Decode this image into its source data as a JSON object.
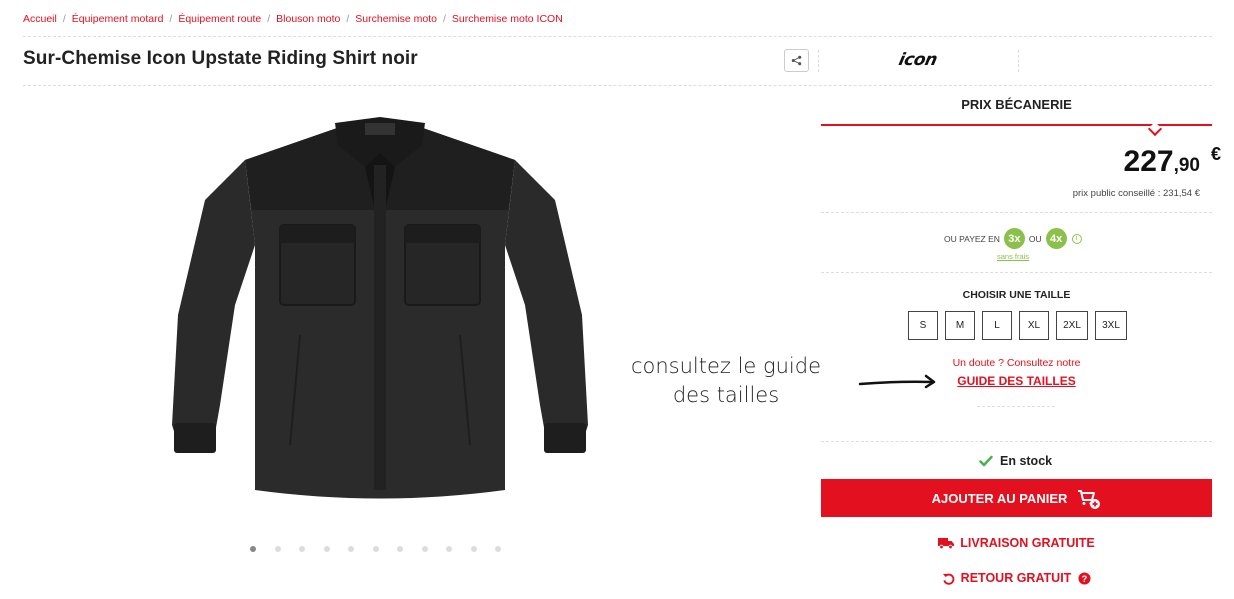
{
  "breadcrumb": [
    "Accueil",
    "Équipement motard",
    "Équipement route",
    "Blouson moto",
    "Surchemise moto",
    "Surchemise moto ICON"
  ],
  "product": {
    "title": "Sur-Chemise Icon Upstate Riding Shirt noir",
    "brand": "icon"
  },
  "gallery": {
    "dot_count": 11,
    "active_index": 0
  },
  "annotation": {
    "line1": "consultez le guide",
    "line2": "des tailles"
  },
  "pricing": {
    "header": "PRIX BÉCANERIE",
    "price_int": "227",
    "price_dec": ",90",
    "currency": "€",
    "public_price": "prix public conseillé : 231,54 €",
    "pay_prefix": "OU PAYEZ EN",
    "pay_3x": "3x",
    "pay_or": "OU",
    "pay_4x": "4x",
    "no_fees": "sans frais"
  },
  "sizes": {
    "label": "CHOISIR UNE TAILLE",
    "options": [
      "S",
      "M",
      "L",
      "XL",
      "2XL",
      "3XL"
    ]
  },
  "size_help": {
    "doubt": "Un doute ? Consultez notre",
    "guide_link": "GUIDE DES TAILLES"
  },
  "stock": {
    "label": "En stock"
  },
  "cart": {
    "button": "AJOUTER AU PANIER"
  },
  "features": {
    "delivery": "LIVRAISON GRATUITE",
    "returns": "RETOUR GRATUIT"
  },
  "colors": {
    "accent": "#e3101f",
    "green": "#8bc14a"
  }
}
